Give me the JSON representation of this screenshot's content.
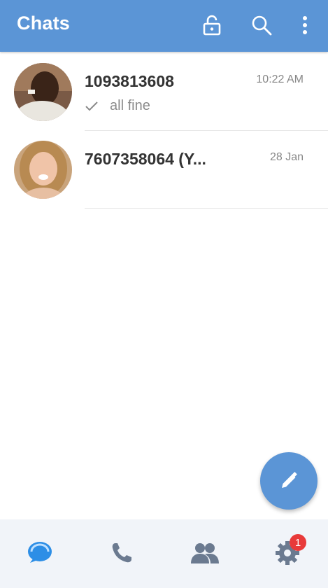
{
  "header": {
    "title": "Chats"
  },
  "chats": [
    {
      "name": "1093813608",
      "time": "10:22 AM",
      "preview": "all fine",
      "read_status": "sent-check",
      "avatar": "man-portrait"
    },
    {
      "name": "7607358064 (Y...",
      "time": "28 Jan",
      "preview": "",
      "avatar": "woman-portrait"
    }
  ],
  "fab": {
    "icon": "pencil-icon"
  },
  "bottom_nav": {
    "tabs": [
      "chats-tab",
      "calls-tab",
      "contacts-tab",
      "settings-tab"
    ],
    "settings_badge": "1"
  },
  "colors": {
    "primary": "#5b95d6",
    "badge": "#e83a3a",
    "active_tab": "#2d8ee6",
    "inactive_tab": "#6b7a90"
  }
}
